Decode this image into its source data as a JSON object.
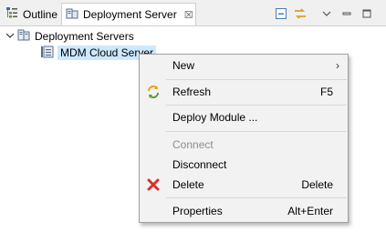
{
  "tabs": [
    {
      "label": "Outline",
      "icon": "outline-icon"
    },
    {
      "label": "Deployment Server",
      "icon": "deployment-server-icon",
      "active": true
    }
  ],
  "tab_close_glyph": "☒",
  "toolbar": {
    "icons": [
      "collapse-all-icon",
      "link-with-editor-icon",
      "view-menu-icon",
      "minimize-icon",
      "maximize-icon"
    ]
  },
  "tree": {
    "root": {
      "label": "Deployment Servers",
      "expanded": true,
      "icon": "server-group-icon"
    },
    "child": {
      "label": "MDM Cloud Server",
      "selected": true,
      "icon": "server-icon",
      "selection_color": "#cce8ff"
    }
  },
  "context_menu": {
    "new": {
      "label": "New",
      "submenu_glyph": "›"
    },
    "refresh": {
      "label": "Refresh",
      "accelerator": "F5",
      "icon": "refresh-icon"
    },
    "deploy_module": {
      "label": "Deploy Module ..."
    },
    "connect": {
      "label": "Connect",
      "enabled": false
    },
    "disconnect": {
      "label": "Disconnect"
    },
    "delete": {
      "label": "Delete",
      "accelerator": "Delete",
      "icon": "delete-icon"
    },
    "properties": {
      "label": "Properties",
      "accelerator": "Alt+Enter"
    }
  },
  "colors": {
    "menu_bg": "#f2f2f2",
    "selection": "#cce8ff",
    "disabled_text": "#8d8d8d",
    "delete_red": "#d9302f",
    "refresh_orange": "#e8a317"
  }
}
